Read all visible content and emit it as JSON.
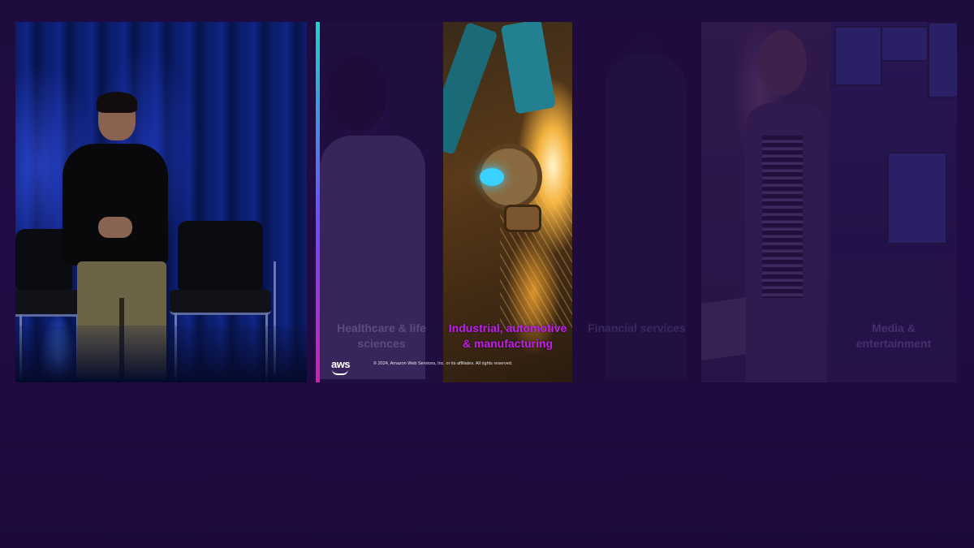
{
  "colors": {
    "background": "#1e0c3e",
    "highlight_caption": "#c01ef0",
    "accent_bar_top": "#19d6c8",
    "accent_bar_bottom": "#d01fb0"
  },
  "camera": {
    "icon": "speaker-video-feed"
  },
  "slide": {
    "panels": [
      {
        "caption": "Healthcare & life sciences",
        "highlighted": false
      },
      {
        "caption": "Industrial, automotive & manufacturing",
        "highlighted": true
      },
      {
        "caption": "Financial services",
        "highlighted": false
      },
      {
        "caption": "",
        "highlighted": false
      },
      {
        "caption": "Media & entertainment",
        "highlighted": false
      }
    ],
    "logo": "aws",
    "copyright": "© 2024, Amazon Web Services, Inc. or its affiliates. All rights reserved."
  }
}
